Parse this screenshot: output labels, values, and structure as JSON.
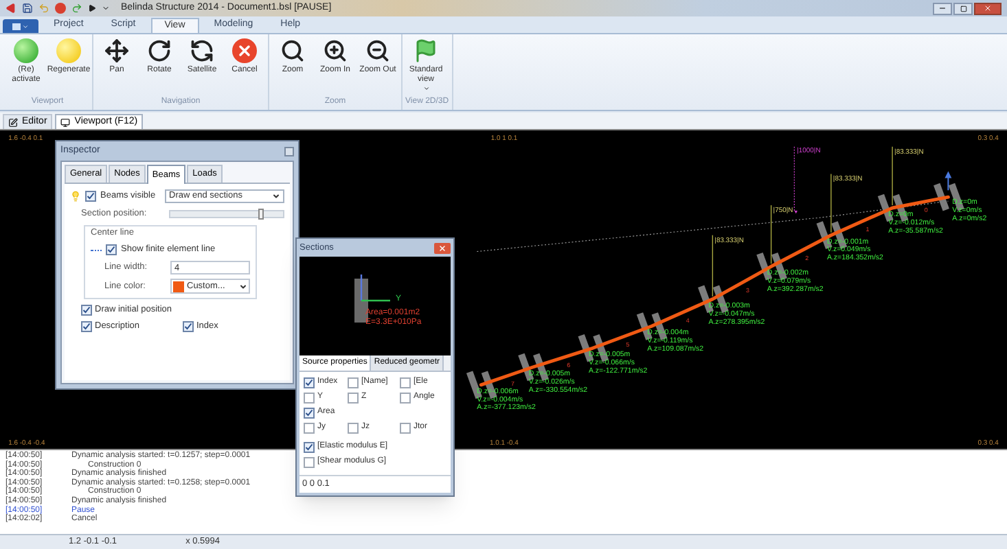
{
  "title_bar": {
    "title": "Belinda Structure 2014 - Document1.bsl [PAUSE]"
  },
  "ribbon": {
    "tabs": [
      {
        "label": "Project",
        "selected": false
      },
      {
        "label": "Script",
        "selected": false
      },
      {
        "label": "View",
        "selected": true
      },
      {
        "label": "Modeling",
        "selected": false
      },
      {
        "label": "Help",
        "selected": false
      }
    ],
    "groups": [
      {
        "label": "Viewport",
        "buttons": [
          {
            "label": "(Re) activate",
            "kind": "activate"
          },
          {
            "label": "Regenerate",
            "kind": "regenerate"
          }
        ]
      },
      {
        "label": "Navigation",
        "buttons": [
          {
            "label": "Pan",
            "kind": "pan"
          },
          {
            "label": "Rotate",
            "kind": "rotate"
          },
          {
            "label": "Satellite",
            "kind": "satellite"
          },
          {
            "label": "Cancel",
            "kind": "cancel"
          }
        ]
      },
      {
        "label": "Zoom",
        "buttons": [
          {
            "label": "Zoom",
            "kind": "zoom"
          },
          {
            "label": "Zoom In",
            "kind": "zoom-in"
          },
          {
            "label": "Zoom Out",
            "kind": "zoom-out"
          }
        ]
      },
      {
        "label": "View 2D/3D",
        "buttons": [
          {
            "label": "Standard view",
            "kind": "flag",
            "dropdown": true
          }
        ]
      }
    ]
  },
  "document_tabs": [
    {
      "label": "Editor",
      "kind": "editor",
      "selected": false
    },
    {
      "label": "Viewport (F12)",
      "kind": "viewport",
      "selected": true
    }
  ],
  "viewport": {
    "corner_labels": [
      "1.6 -0.4 0.1",
      "1.0 1 0.1",
      "0.3 0.4",
      "1.6 -0.4 -0.4",
      "1.0.1 -0.4",
      "0.3 0.4"
    ],
    "point_load": "|1000|N",
    "element_labels": [
      "7",
      "6",
      "5",
      "4",
      "3",
      "2",
      "1",
      "0"
    ],
    "nodes": [
      {
        "readings": [
          "D.z=-0.006m",
          "V.z=-0.004m/s",
          "A.z=-377.123m/s2"
        ]
      },
      {
        "readings": [
          "D.z=-0.005m",
          "V.z=-0.026m/s",
          "A.z=-330.554m/s2"
        ]
      },
      {
        "readings": [
          "D.z=-0.005m",
          "V.z=-0.066m/s",
          "A.z=-122.771m/s2"
        ]
      },
      {
        "readings": [
          "D.z=-0.004m",
          "V.z=-0.119m/s",
          "A.z=109.087m/s2"
        ]
      },
      {
        "readings": [
          "D.z=-0.003m",
          "V.z=-0.047m/s",
          "A.z=278.395m/s2"
        ],
        "load": "|83.333|N"
      },
      {
        "readings": [
          "D.z=-0.002m",
          "V.z=0.079m/s",
          "A.z=392.287m/s2"
        ],
        "load": "|750|N"
      },
      {
        "readings": [
          "D.z=-0.001m",
          "V.z=0.049m/s",
          "A.z=184.352m/s2"
        ],
        "load": "|83.333|N"
      },
      {
        "readings": [
          "D.z=0m",
          "V.z=-0.012m/s",
          "A.z=-35.587m/s2"
        ],
        "load": "|83.333|N"
      },
      {
        "readings": [
          "D.z=0m",
          "V.z=0m/s",
          "A.z=0m/s2"
        ]
      }
    ]
  },
  "inspector": {
    "title": "Inspector",
    "tabs": [
      {
        "label": "General",
        "selected": false
      },
      {
        "label": "Nodes",
        "selected": false
      },
      {
        "label": "Beams",
        "selected": true
      },
      {
        "label": "Loads",
        "selected": false
      }
    ],
    "beams_visible": {
      "label": "Beams visible",
      "checked": true
    },
    "draw_mode": "Draw end sections",
    "section_position": {
      "label": "Section position:",
      "level": 0.8
    },
    "center_line": {
      "title": "Center line",
      "show_line": {
        "label": "Show finite element line",
        "checked": true
      },
      "line_width": {
        "label": "Line width:",
        "value": "4"
      },
      "line_color": {
        "label": "Line color:",
        "value": "Custom...",
        "color": "#f05a14"
      }
    },
    "options": [
      {
        "label": "Draw initial position",
        "checked": true
      },
      {
        "label": "Description",
        "checked": true
      },
      {
        "label": "Index",
        "checked": true
      }
    ]
  },
  "sections": {
    "title": "Sections",
    "preview": {
      "axis_label": "Y",
      "lines": [
        "Area=0.001m2",
        "E=3.3E+010Pa"
      ]
    },
    "tabs": [
      {
        "label": "Source properties",
        "selected": true
      },
      {
        "label": "Reduced geometr",
        "selected": false
      }
    ],
    "rows": [
      [
        {
          "label": "Index",
          "checked": true
        },
        {
          "label": "[Name]",
          "checked": false
        },
        {
          "label": "[Ele",
          "checked": false
        }
      ],
      [
        {
          "label": "Y",
          "checked": false
        },
        {
          "label": "Z",
          "checked": false
        },
        {
          "label": "Angle",
          "checked": false
        }
      ],
      [
        {
          "label": "Area",
          "checked": true
        }
      ],
      [
        {
          "label": "Jy",
          "checked": false
        },
        {
          "label": "Jz",
          "checked": false
        },
        {
          "label": "Jtor",
          "checked": false
        }
      ],
      [
        {
          "label": "[Elastic modulus E]",
          "checked": true
        }
      ],
      [
        {
          "label": "[Shear modulus G]",
          "checked": false
        }
      ]
    ],
    "field": "0 0 0.1"
  },
  "log": [
    {
      "time": "[14:00:50]",
      "message": "Dynamic analysis started: t=0.1257; step=0.0001",
      "kind": "info"
    },
    {
      "time": "[14:00:50]",
      "message": "Construction 0",
      "kind": "sub"
    },
    {
      "time": "[14:00:50]",
      "message": "Dynamic analysis finished",
      "kind": "info"
    },
    {
      "time": "[14:00:50]",
      "message": "Dynamic analysis started: t=0.1258; step=0.0001",
      "kind": "info"
    },
    {
      "time": "[14:00:50]",
      "message": "Construction 0",
      "kind": "sub"
    },
    {
      "time": "[14:00:50]",
      "message": "Dynamic analysis finished",
      "kind": "info"
    },
    {
      "time": "[14:00:50]",
      "message": "Pause",
      "kind": "highlight"
    },
    {
      "time": "[14:02:02]",
      "message": "Cancel",
      "kind": "info"
    }
  ],
  "status_bar": [
    "1.2 -0.1 -0.1",
    "x 0.5994"
  ]
}
